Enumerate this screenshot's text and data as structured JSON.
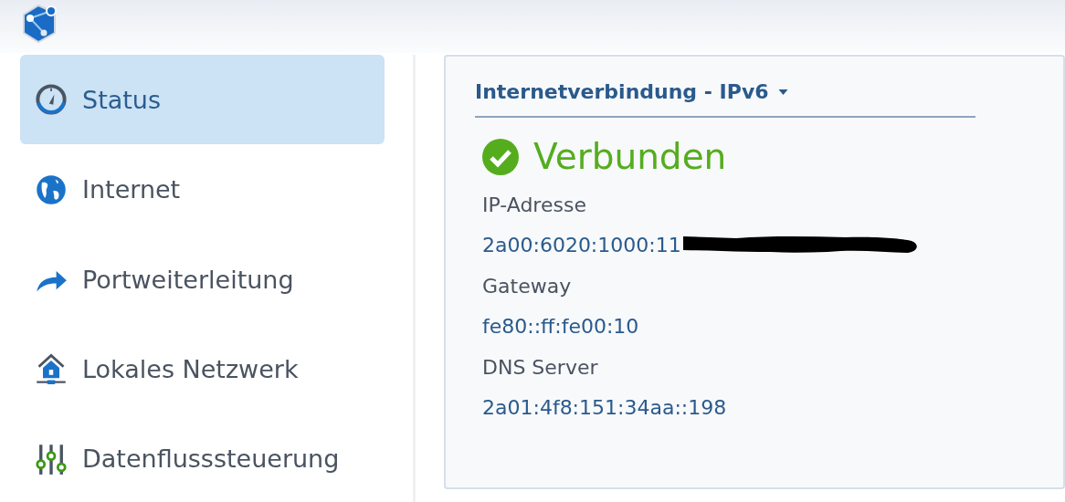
{
  "sidebar": {
    "items": [
      {
        "label": "Status",
        "selected": true
      },
      {
        "label": "Internet",
        "selected": false
      },
      {
        "label": "Portweiterleitung",
        "selected": false
      },
      {
        "label": "Lokales Netzwerk",
        "selected": false
      },
      {
        "label": "Datenflusssteuerung",
        "selected": false
      }
    ]
  },
  "panel": {
    "title": "Internetverbindung - IPv6",
    "status": {
      "text": "Verbunden",
      "connected": true
    },
    "fields": [
      {
        "label": "IP-Adresse",
        "value": "2a00:6020:1000:11",
        "redacted": true
      },
      {
        "label": "Gateway",
        "value": "fe80::ff:fe00:10",
        "redacted": false
      },
      {
        "label": "DNS Server",
        "value": "2a01:4f8:151:34aa::198",
        "redacted": false
      }
    ]
  }
}
